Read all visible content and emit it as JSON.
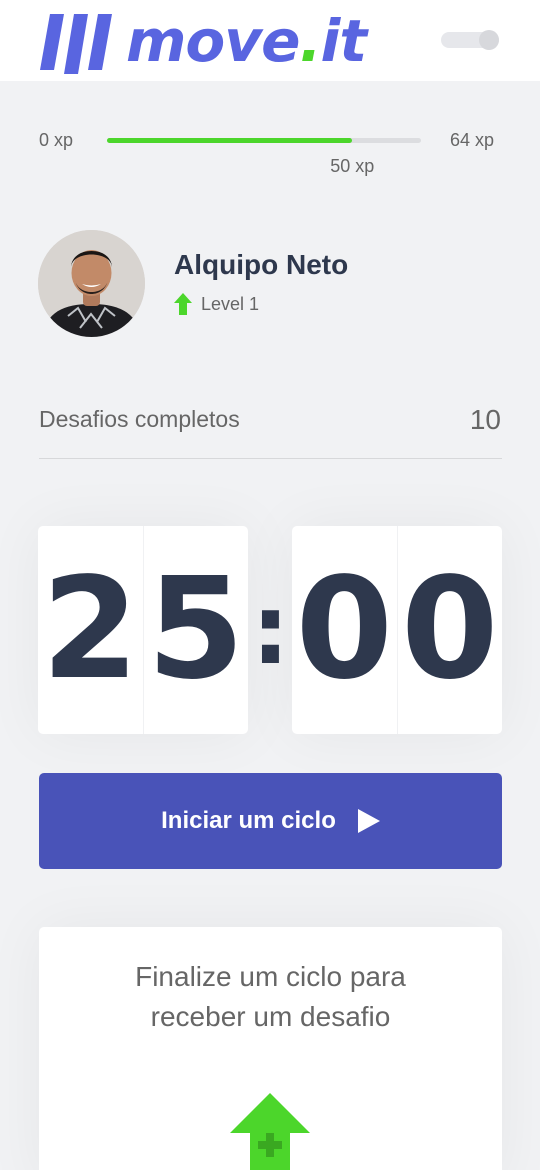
{
  "app": {
    "logo_text_main": "move",
    "logo_text_dot": ".",
    "logo_text_suffix": "it",
    "brand_color": "#5965e0",
    "accent_color": "#4cd62b"
  },
  "theme_toggle": {
    "state": "off"
  },
  "experience": {
    "min_label": "0 xp",
    "max_label": "64 xp",
    "current_label": "50 xp",
    "current": 50,
    "max": 64
  },
  "profile": {
    "name": "Alquipo Neto",
    "level_label": "Level 1",
    "level_icon": "level-up-arrow-icon"
  },
  "completed_challenges": {
    "label": "Desafios completos",
    "value": "10"
  },
  "countdown": {
    "minute_left": "2",
    "minute_right": "5",
    "separator": ":",
    "second_left": "0",
    "second_right": "0"
  },
  "start_button": {
    "label": "Iniciar um ciclo",
    "icon": "play-icon",
    "color": "#4953b8"
  },
  "challenge_box": {
    "line1": "Finalize um ciclo para",
    "line2": "receber um desafio",
    "icon": "level-up-icon"
  }
}
